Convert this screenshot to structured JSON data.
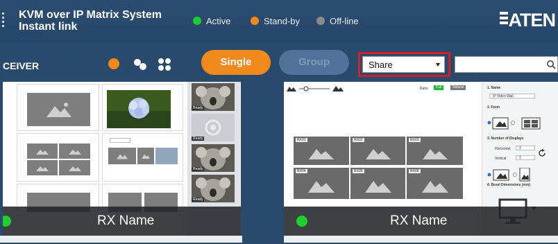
{
  "header": {
    "title_line1": "KVM over IP Matrix System",
    "title_line2": "Instant link",
    "legend": [
      {
        "label": "Active",
        "color": "#1fcb32"
      },
      {
        "label": "Stand-by",
        "color": "#f08a1c"
      },
      {
        "label": "Off-line",
        "color": "#8a8a8a"
      }
    ],
    "logo": "ATEN"
  },
  "toolbar": {
    "section_label": "CEIVER",
    "single_label": "Single",
    "group_label": "Group",
    "share_value": "Share",
    "search_placeholder": ""
  },
  "colors": {
    "accent": "#f08a1c",
    "group_pill": "#51739a",
    "highlight": "#d11f2b"
  },
  "left_card": {
    "rx_name": "RX Name",
    "strip_tags": [
      "Ready",
      "Ready",
      "Ready",
      "Ready"
    ]
  },
  "right_card": {
    "rx_name": "RX Name",
    "ratio_label": "Ratio",
    "ratio_options": [
      "Full",
      "Natural"
    ],
    "panel": {
      "name_head": "1. Name",
      "name_value": "IP Video Wall",
      "form_head": "2. Form",
      "displays_head": "3. Number of Displays",
      "horizontal_label": "Horizontal",
      "horizontal_value": "3",
      "vertical_label": "Vertical",
      "vertical_value": "2",
      "bezel_head": "4. Bezel Dimensions (mm)"
    },
    "monitors": [
      {
        "tag": "RX01"
      },
      {
        "tag": "RX02"
      },
      {
        "tag": "RX03"
      },
      {
        "tag": "RX04"
      },
      {
        "tag": "RX05"
      },
      {
        "tag": "RX06"
      }
    ]
  }
}
